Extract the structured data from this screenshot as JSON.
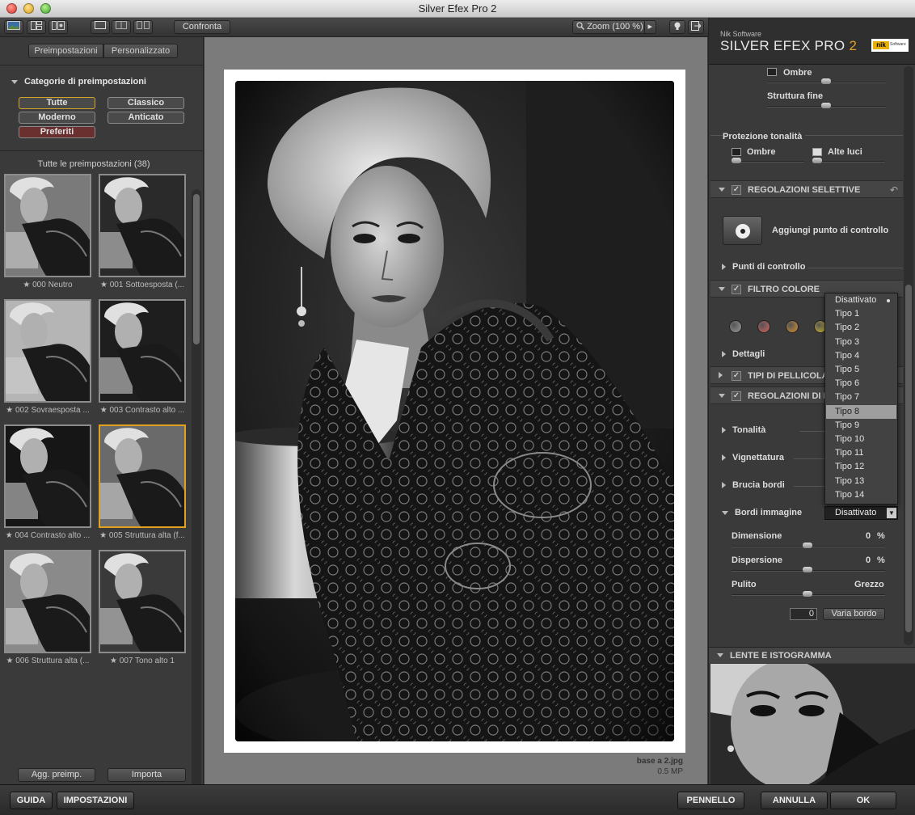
{
  "window": {
    "title": "Silver Efex Pro 2"
  },
  "toolbar": {
    "compare_label": "Confronta",
    "zoom_label": "Zoom (100 %)"
  },
  "left_panel": {
    "tabs": [
      "Preimpostazioni",
      "Personalizzato"
    ],
    "categories_title": "Categorie di preimpostazioni",
    "categories": [
      "Tutte",
      "Classico",
      "Moderno",
      "Anticato",
      "Preferiti"
    ],
    "selected_category": "Tutte",
    "presets_title": "Tutte le preimpostazioni (38)",
    "presets": [
      "000 Neutro",
      "001 Sottoesposta (...",
      "002 Sovraesposta ...",
      "003 Contrasto alto ...",
      "004 Contrasto alto ...",
      "005 Struttura alta (f...",
      "006 Struttura alta (...",
      "007 Tono alto 1"
    ],
    "selected_preset": "005 Struttura alta (f...",
    "add_preset_label": "Agg. preimp.",
    "import_label": "Importa"
  },
  "canvas": {
    "file_name": "base a 2.jpg",
    "file_size": "0.5 MP"
  },
  "right_panel": {
    "brand_small": "Nik Software",
    "brand_main": "SILVER EFEX PRO",
    "brand_version": "2",
    "brand_badge": "nik",
    "brand_badge_sub": "Software",
    "shadows_label": "Ombre",
    "fine_structure_label": "Struttura fine",
    "tonal_protection_title": "Protezione tonalità",
    "tonal_shadows_label": "Ombre",
    "tonal_highlights_label": "Alte luci",
    "selective_title": "REGOLAZIONI SELETTIVE",
    "add_control_point_label": "Aggiungi punto di controllo",
    "control_points_label": "Punti di controllo",
    "color_filter_title": "FILTRO COLORE",
    "filter_colors": [
      "#9a9a9a",
      "#d36060",
      "#d89030",
      "#d8c030"
    ],
    "details_label": "Dettagli",
    "film_types_title": "TIPI DI PELLICOLA",
    "finishing_title": "REGOLAZIONI DI F",
    "toning_label": "Tonalità",
    "vignette_label": "Vignettatura",
    "burn_edges_label": "Brucia bordi",
    "image_borders_label": "Bordi immagine",
    "border_select_value": "Disattivato",
    "size_label": "Dimensione",
    "size_value": "0",
    "size_unit": "%",
    "spread_label": "Dispersione",
    "spread_value": "0",
    "spread_unit": "%",
    "clean_label": "Pulito",
    "rough_label": "Grezzo",
    "border_variant_value": "0",
    "vary_border_label": "Varia bordo",
    "loupe_title": "LENTE E ISTOGRAMMA"
  },
  "dropdown": {
    "options": [
      "Disattivato",
      "Tipo 1",
      "Tipo 2",
      "Tipo 3",
      "Tipo 4",
      "Tipo 5",
      "Tipo 6",
      "Tipo 7",
      "Tipo 8",
      "Tipo 9",
      "Tipo 10",
      "Tipo 11",
      "Tipo 12",
      "Tipo 13",
      "Tipo 14"
    ],
    "highlighted": "Tipo 8",
    "checked": "Disattivato"
  },
  "bottom_bar": {
    "help_label": "GUIDA",
    "settings_label": "IMPOSTAZIONI",
    "brush_label": "PENNELLO",
    "cancel_label": "ANNULLA",
    "ok_label": "OK"
  }
}
